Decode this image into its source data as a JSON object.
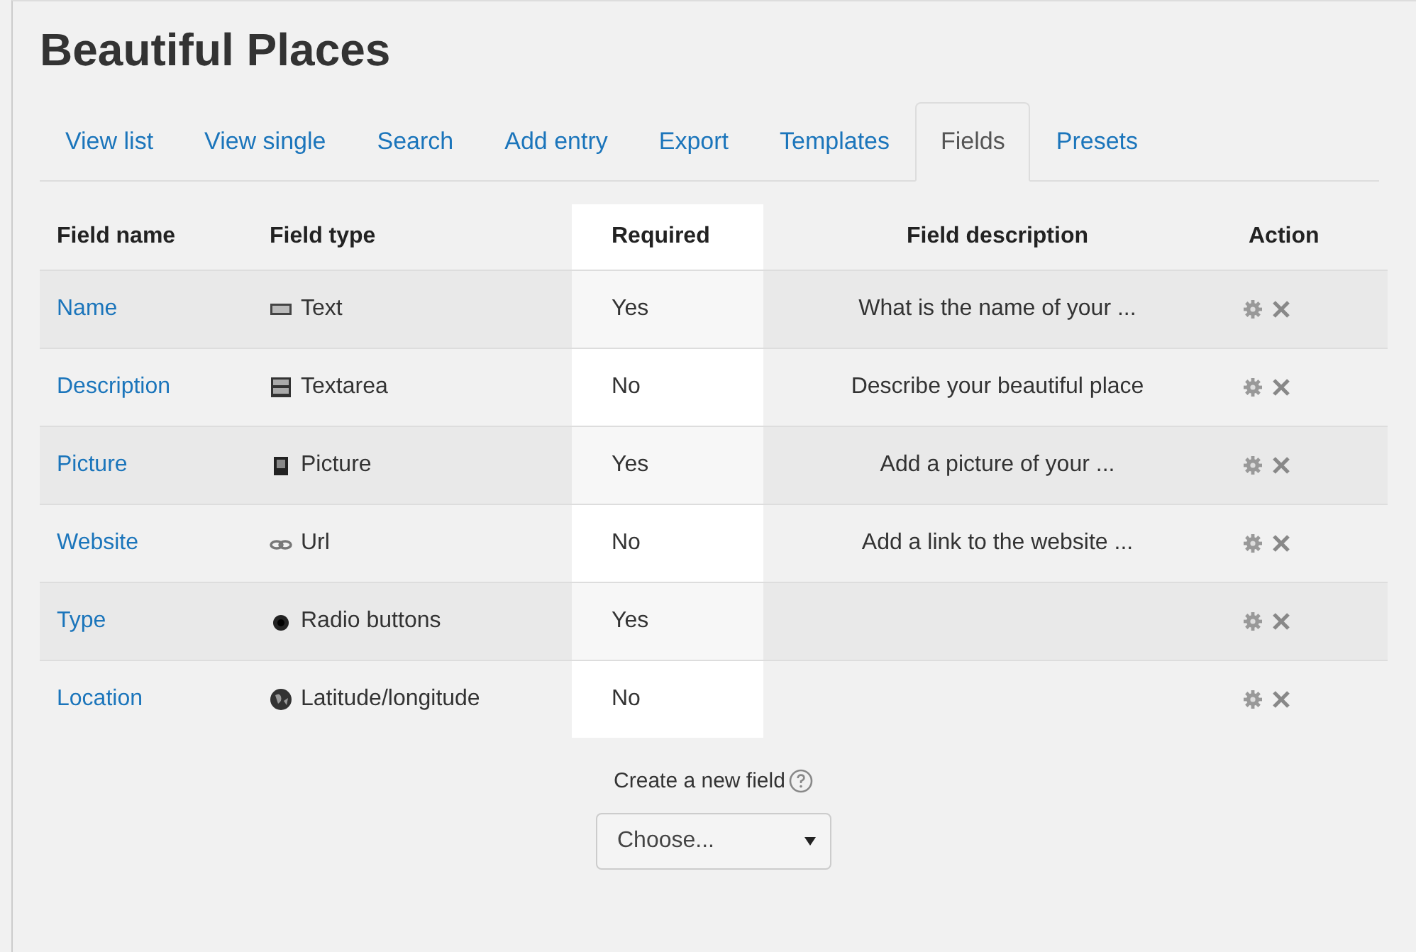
{
  "title": "Beautiful Places",
  "tabs": [
    {
      "label": "View list",
      "selected": false
    },
    {
      "label": "View single",
      "selected": false
    },
    {
      "label": "Search",
      "selected": false
    },
    {
      "label": "Add entry",
      "selected": false
    },
    {
      "label": "Export",
      "selected": false
    },
    {
      "label": "Templates",
      "selected": false
    },
    {
      "label": "Fields",
      "selected": true
    },
    {
      "label": "Presets",
      "selected": false
    }
  ],
  "table": {
    "columns": [
      "Field name",
      "Field type",
      "Required",
      "Field description",
      "Action"
    ],
    "rows": [
      {
        "name": "Name",
        "type": "Text",
        "kind": "text",
        "required": "Yes",
        "description": "What is the name of your ..."
      },
      {
        "name": "Description",
        "type": "Textarea",
        "kind": "textarea",
        "required": "No",
        "description": "Describe your beautiful place"
      },
      {
        "name": "Picture",
        "type": "Picture",
        "kind": "picture",
        "required": "Yes",
        "description": "Add a picture of your ..."
      },
      {
        "name": "Website",
        "type": "Url",
        "kind": "url",
        "required": "No",
        "description": "Add a link to the website ..."
      },
      {
        "name": "Type",
        "type": "Radio buttons",
        "kind": "radio",
        "required": "Yes"
      },
      {
        "name": "Location",
        "type": "Latitude/longitude",
        "kind": "latlong",
        "required": "No"
      }
    ]
  },
  "create_field": {
    "label": "Create a new field",
    "select": {
      "value": "Choose..."
    }
  }
}
